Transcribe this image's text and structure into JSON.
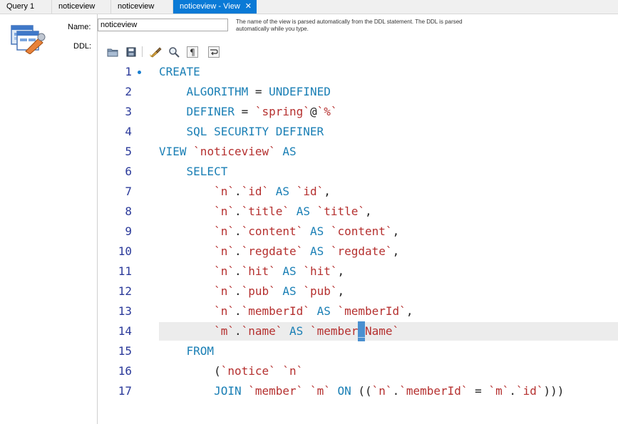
{
  "tabs": [
    {
      "label": "Query 1"
    },
    {
      "label": "noticeview"
    },
    {
      "label": "noticeview"
    },
    {
      "label": "noticeview - View",
      "close": "✕"
    }
  ],
  "form": {
    "name_label": "Name:",
    "name_value": "noticeview",
    "ddl_label": "DDL:",
    "hint": "The name of the view is parsed automatically from the DDL statement. The DDL is parsed automatically while you type."
  },
  "toolbar": {
    "icons": [
      "open-folder-icon",
      "save-icon",
      "beautify-brush-icon",
      "find-icon",
      "pilcrow-icon",
      "word-wrap-icon"
    ]
  },
  "colors": {
    "keyword": "#1a7fb5",
    "string": "#b5302f",
    "line_number": "#2b3a9a",
    "active_tab": "#0a7ad6"
  },
  "code": {
    "lines": [
      {
        "n": "1",
        "marker": true,
        "tokens": [
          {
            "t": "CREATE",
            "c": "k"
          }
        ]
      },
      {
        "n": "2",
        "tokens": [
          {
            "t": "    ",
            "c": "p"
          },
          {
            "t": "ALGORITHM",
            "c": "k"
          },
          {
            "t": " = ",
            "c": "p"
          },
          {
            "t": "UNDEFINED",
            "c": "k"
          }
        ]
      },
      {
        "n": "3",
        "tokens": [
          {
            "t": "    ",
            "c": "p"
          },
          {
            "t": "DEFINER",
            "c": "k"
          },
          {
            "t": " = ",
            "c": "p"
          },
          {
            "t": "`spring`",
            "c": "s"
          },
          {
            "t": "@",
            "c": "p"
          },
          {
            "t": "`%`",
            "c": "s"
          }
        ]
      },
      {
        "n": "4",
        "tokens": [
          {
            "t": "    ",
            "c": "p"
          },
          {
            "t": "SQL SECURITY DEFINER",
            "c": "k"
          }
        ]
      },
      {
        "n": "5",
        "tokens": [
          {
            "t": "VIEW",
            "c": "k"
          },
          {
            "t": " ",
            "c": "p"
          },
          {
            "t": "`noticeview`",
            "c": "s"
          },
          {
            "t": " ",
            "c": "p"
          },
          {
            "t": "AS",
            "c": "k"
          }
        ]
      },
      {
        "n": "6",
        "tokens": [
          {
            "t": "    ",
            "c": "p"
          },
          {
            "t": "SELECT",
            "c": "k"
          }
        ]
      },
      {
        "n": "7",
        "tokens": [
          {
            "t": "        ",
            "c": "p"
          },
          {
            "t": "`n`",
            "c": "s"
          },
          {
            "t": ".",
            "c": "p"
          },
          {
            "t": "`id`",
            "c": "s"
          },
          {
            "t": " ",
            "c": "p"
          },
          {
            "t": "AS",
            "c": "k"
          },
          {
            "t": " ",
            "c": "p"
          },
          {
            "t": "`id`",
            "c": "s"
          },
          {
            "t": ",",
            "c": "p"
          }
        ]
      },
      {
        "n": "8",
        "tokens": [
          {
            "t": "        ",
            "c": "p"
          },
          {
            "t": "`n`",
            "c": "s"
          },
          {
            "t": ".",
            "c": "p"
          },
          {
            "t": "`title`",
            "c": "s"
          },
          {
            "t": " ",
            "c": "p"
          },
          {
            "t": "AS",
            "c": "k"
          },
          {
            "t": " ",
            "c": "p"
          },
          {
            "t": "`title`",
            "c": "s"
          },
          {
            "t": ",",
            "c": "p"
          }
        ]
      },
      {
        "n": "9",
        "tokens": [
          {
            "t": "        ",
            "c": "p"
          },
          {
            "t": "`n`",
            "c": "s"
          },
          {
            "t": ".",
            "c": "p"
          },
          {
            "t": "`content`",
            "c": "s"
          },
          {
            "t": " ",
            "c": "p"
          },
          {
            "t": "AS",
            "c": "k"
          },
          {
            "t": " ",
            "c": "p"
          },
          {
            "t": "`content`",
            "c": "s"
          },
          {
            "t": ",",
            "c": "p"
          }
        ]
      },
      {
        "n": "10",
        "tokens": [
          {
            "t": "        ",
            "c": "p"
          },
          {
            "t": "`n`",
            "c": "s"
          },
          {
            "t": ".",
            "c": "p"
          },
          {
            "t": "`regdate`",
            "c": "s"
          },
          {
            "t": " ",
            "c": "p"
          },
          {
            "t": "AS",
            "c": "k"
          },
          {
            "t": " ",
            "c": "p"
          },
          {
            "t": "`regdate`",
            "c": "s"
          },
          {
            "t": ",",
            "c": "p"
          }
        ]
      },
      {
        "n": "11",
        "tokens": [
          {
            "t": "        ",
            "c": "p"
          },
          {
            "t": "`n`",
            "c": "s"
          },
          {
            "t": ".",
            "c": "p"
          },
          {
            "t": "`hit`",
            "c": "s"
          },
          {
            "t": " ",
            "c": "p"
          },
          {
            "t": "AS",
            "c": "k"
          },
          {
            "t": " ",
            "c": "p"
          },
          {
            "t": "`hit`",
            "c": "s"
          },
          {
            "t": ",",
            "c": "p"
          }
        ]
      },
      {
        "n": "12",
        "tokens": [
          {
            "t": "        ",
            "c": "p"
          },
          {
            "t": "`n`",
            "c": "s"
          },
          {
            "t": ".",
            "c": "p"
          },
          {
            "t": "`pub`",
            "c": "s"
          },
          {
            "t": " ",
            "c": "p"
          },
          {
            "t": "AS",
            "c": "k"
          },
          {
            "t": " ",
            "c": "p"
          },
          {
            "t": "`pub`",
            "c": "s"
          },
          {
            "t": ",",
            "c": "p"
          }
        ]
      },
      {
        "n": "13",
        "tokens": [
          {
            "t": "        ",
            "c": "p"
          },
          {
            "t": "`n`",
            "c": "s"
          },
          {
            "t": ".",
            "c": "p"
          },
          {
            "t": "`memberId`",
            "c": "s"
          },
          {
            "t": " ",
            "c": "p"
          },
          {
            "t": "AS",
            "c": "k"
          },
          {
            "t": " ",
            "c": "p"
          },
          {
            "t": "`memberId`",
            "c": "s"
          },
          {
            "t": ",",
            "c": "p"
          }
        ]
      },
      {
        "n": "14",
        "highlight": true,
        "tokens": [
          {
            "t": "        ",
            "c": "p"
          },
          {
            "t": "`m`",
            "c": "s"
          },
          {
            "t": ".",
            "c": "p"
          },
          {
            "t": "`name`",
            "c": "s"
          },
          {
            "t": " ",
            "c": "p"
          },
          {
            "t": "AS",
            "c": "k"
          },
          {
            "t": " ",
            "c": "p"
          },
          {
            "t": "`member",
            "c": "s"
          },
          {
            "t": "_",
            "c": "cursor"
          },
          {
            "t": "Name`",
            "c": "s"
          }
        ]
      },
      {
        "n": "15",
        "tokens": [
          {
            "t": "    ",
            "c": "p"
          },
          {
            "t": "FROM",
            "c": "k"
          }
        ]
      },
      {
        "n": "16",
        "tokens": [
          {
            "t": "        ",
            "c": "p"
          },
          {
            "t": "(",
            "c": "p"
          },
          {
            "t": "`notice`",
            "c": "s"
          },
          {
            "t": " ",
            "c": "p"
          },
          {
            "t": "`n`",
            "c": "s"
          }
        ]
      },
      {
        "n": "17",
        "tokens": [
          {
            "t": "        ",
            "c": "p"
          },
          {
            "t": "JOIN",
            "c": "k"
          },
          {
            "t": " ",
            "c": "p"
          },
          {
            "t": "`member`",
            "c": "s"
          },
          {
            "t": " ",
            "c": "p"
          },
          {
            "t": "`m`",
            "c": "s"
          },
          {
            "t": " ",
            "c": "p"
          },
          {
            "t": "ON",
            "c": "k"
          },
          {
            "t": " ((",
            "c": "p"
          },
          {
            "t": "`n`",
            "c": "s"
          },
          {
            "t": ".",
            "c": "p"
          },
          {
            "t": "`memberId`",
            "c": "s"
          },
          {
            "t": " = ",
            "c": "p"
          },
          {
            "t": "`m`",
            "c": "s"
          },
          {
            "t": ".",
            "c": "p"
          },
          {
            "t": "`id`",
            "c": "s"
          },
          {
            "t": ")))",
            "c": "p"
          }
        ]
      }
    ]
  }
}
